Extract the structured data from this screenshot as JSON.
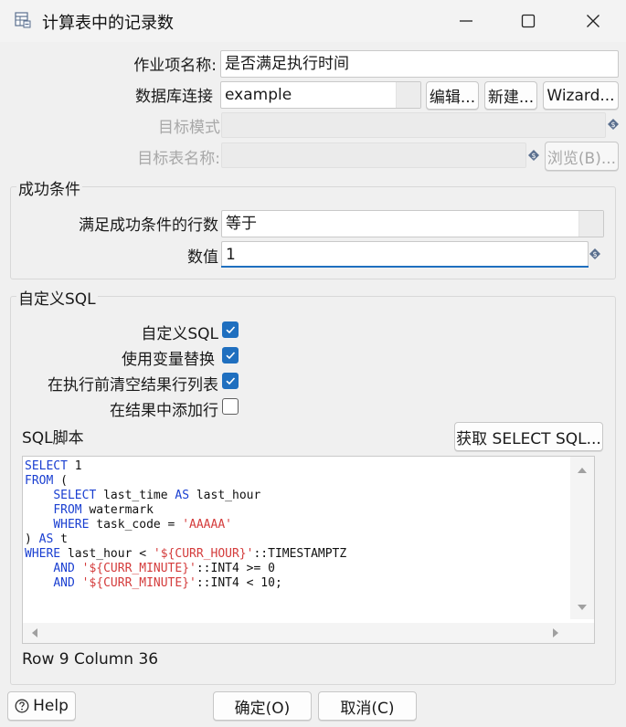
{
  "window": {
    "title": "计算表中的记录数",
    "minimize_icon": "minimize-icon",
    "maximize_icon": "maximize-icon",
    "close_icon": "close-icon"
  },
  "form": {
    "job_name_label": "作业项名称:",
    "job_name_value": "是否满足执行时间",
    "db_connection_label": "数据库连接",
    "db_connection_value": "example",
    "edit_button": "编辑...",
    "new_button": "新建...",
    "wizard_button": "Wizard...",
    "target_schema_label": "目标模式",
    "target_schema_value": "",
    "target_table_label": "目标表名称:",
    "target_table_value": "",
    "browse_button": "浏览(B)..."
  },
  "success_condition": {
    "group_title": "成功条件",
    "row_count_label": "满足成功条件的行数",
    "row_count_value": "等于",
    "value_label": "数值",
    "value_value": "1"
  },
  "custom_sql": {
    "group_title": "自定义SQL",
    "options": [
      {
        "label": "自定义SQL",
        "checked": true
      },
      {
        "label": "使用变量替换",
        "checked": true
      },
      {
        "label": "在执行前清空结果行列表",
        "checked": true
      },
      {
        "label": "在结果中添加行",
        "checked": false
      }
    ],
    "script_label": "SQL脚本",
    "get_sql_button": "获取 SELECT SQL...",
    "status": "Row 9 Column 36",
    "code_lines": [
      [
        {
          "t": "SELECT",
          "c": "kw"
        },
        {
          "t": " 1",
          "c": ""
        }
      ],
      [
        {
          "t": "FROM",
          "c": "kw"
        },
        {
          "t": " (",
          "c": ""
        }
      ],
      [
        {
          "t": "    ",
          "c": ""
        },
        {
          "t": "SELECT",
          "c": "kw"
        },
        {
          "t": " last_time ",
          "c": ""
        },
        {
          "t": "AS",
          "c": "kw"
        },
        {
          "t": " last_hour",
          "c": ""
        }
      ],
      [
        {
          "t": "    ",
          "c": ""
        },
        {
          "t": "FROM",
          "c": "kw"
        },
        {
          "t": " watermark",
          "c": ""
        }
      ],
      [
        {
          "t": "    ",
          "c": ""
        },
        {
          "t": "WHERE",
          "c": "kw"
        },
        {
          "t": " task_code = ",
          "c": ""
        },
        {
          "t": "'AAAAA'",
          "c": "str"
        }
      ],
      [
        {
          "t": ") ",
          "c": ""
        },
        {
          "t": "AS",
          "c": "kw"
        },
        {
          "t": " t",
          "c": ""
        }
      ],
      [
        {
          "t": "WHERE",
          "c": "kw"
        },
        {
          "t": " last_hour < ",
          "c": ""
        },
        {
          "t": "'${CURR_HOUR}'",
          "c": "str"
        },
        {
          "t": "::TIMESTAMPTZ",
          "c": ""
        }
      ],
      [
        {
          "t": "    ",
          "c": ""
        },
        {
          "t": "AND",
          "c": "kw"
        },
        {
          "t": " ",
          "c": ""
        },
        {
          "t": "'${CURR_MINUTE}'",
          "c": "str"
        },
        {
          "t": "::INT4 >= 0",
          "c": ""
        }
      ],
      [
        {
          "t": "    ",
          "c": ""
        },
        {
          "t": "AND",
          "c": "kw"
        },
        {
          "t": " ",
          "c": ""
        },
        {
          "t": "'${CURR_MINUTE}'",
          "c": "str"
        },
        {
          "t": "::INT4 < 10;",
          "c": ""
        }
      ]
    ]
  },
  "footer": {
    "help_button": "Help",
    "ok_button": "确定(O)",
    "cancel_button": "取消(C)"
  },
  "colors": {
    "accent": "#1f6fbf",
    "keyword": "#1a3fd1",
    "string": "#d43c3c"
  }
}
